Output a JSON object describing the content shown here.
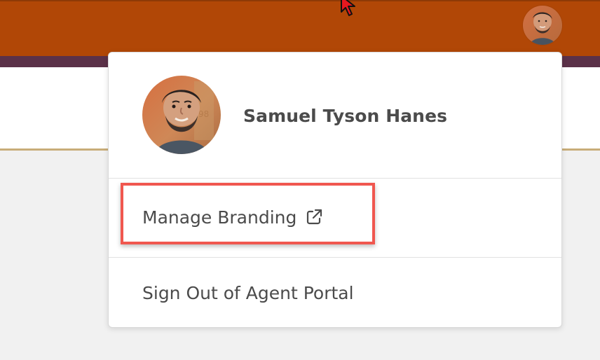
{
  "header": {
    "avatar_icon": "user-avatar-icon",
    "cursor_icon": "cursor-arrow-icon"
  },
  "dropdown": {
    "user_name": "Samuel Tyson Hanes",
    "manage_branding_label": "Manage Branding",
    "manage_branding_icon": "external-link-icon",
    "sign_out_label": "Sign Out of Agent Portal"
  },
  "colors": {
    "header_background": "#b14706",
    "subheader_background": "#5b3148",
    "panel_rule": "#c8ad79",
    "highlight_border": "#f0574f",
    "menu_text": "#4b4b4b"
  }
}
